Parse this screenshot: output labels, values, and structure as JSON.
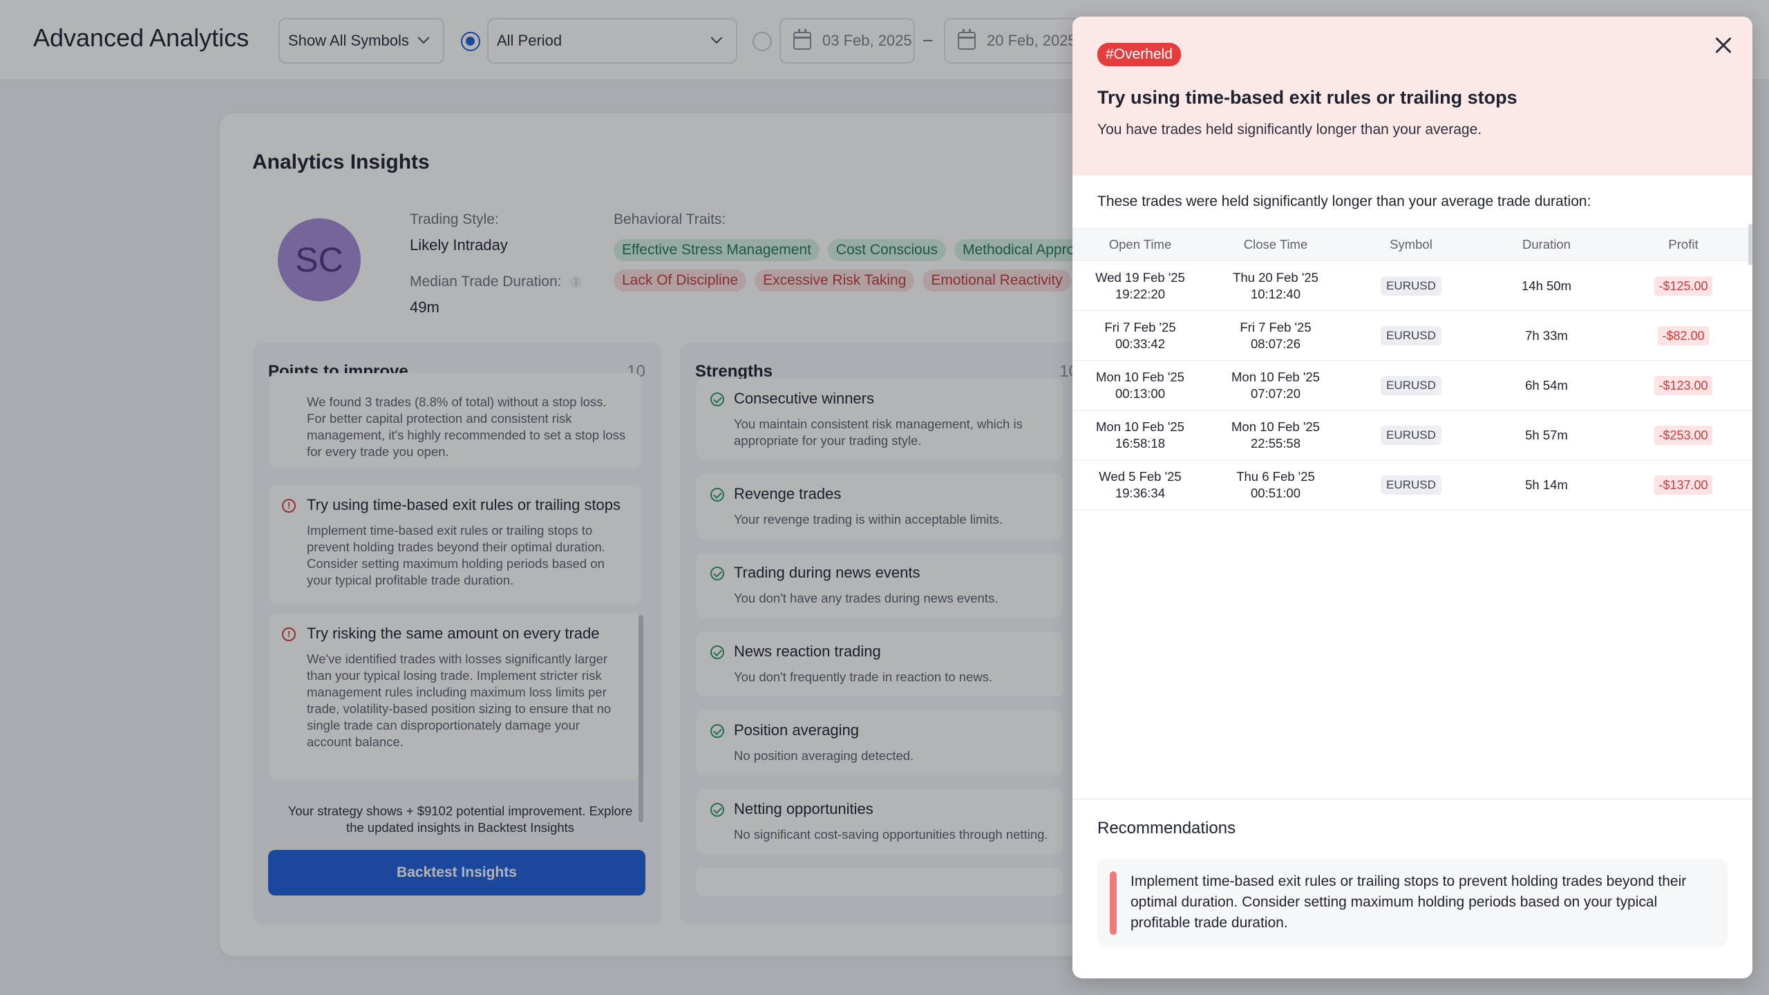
{
  "header": {
    "title": "Advanced Analytics",
    "symbols_select": "Show All Symbols",
    "period_select": "All Period",
    "date_from": "03 Feb, 2025",
    "date_sep": "–",
    "date_to": "20 Feb, 2025"
  },
  "insights": {
    "title": "Analytics Insights",
    "avatar_initials": "SC",
    "trading_style_label": "Trading Style:",
    "trading_style_value": "Likely Intraday",
    "median_label": "Median Trade Duration:",
    "median_value": "49m",
    "traits_label": "Behavioral Traits:",
    "positive_traits": [
      "Effective Stress Management",
      "Cost Conscious",
      "Methodical Approach"
    ],
    "negative_traits": [
      "Lack Of Discipline",
      "Excessive Risk Taking",
      "Emotional Reactivity"
    ]
  },
  "improve": {
    "title": "Points to improve",
    "count": "10",
    "items": [
      {
        "title": "",
        "desc": "We found 3 trades (8.8% of total) without a stop loss. For better capital protection and consistent risk management, it's highly recommended to set a stop loss for every trade you open."
      },
      {
        "title": "Try using time-based exit rules or trailing stops",
        "desc": "Implement time-based exit rules or trailing stops to prevent holding trades beyond their optimal duration. Consider setting maximum holding periods based on your typical profitable trade duration."
      },
      {
        "title": "Try risking the same amount on every trade",
        "desc": "We've identified trades with losses significantly larger than your typical losing trade. Implement stricter risk management rules including maximum loss limits per trade, volatility-based position sizing to ensure that no single trade can disproportionately damage your account balance."
      }
    ],
    "potential_text": "Your strategy shows + $9102 potential improvement. Explore the updated insights in Backtest Insights",
    "button": "Backtest Insights"
  },
  "strengths": {
    "title": "Strengths",
    "count": "10",
    "items": [
      {
        "title": "Consecutive winners",
        "desc": "You maintain consistent risk management, which is appropriate for your trading style."
      },
      {
        "title": "Revenge trades",
        "desc": "Your revenge trading is within acceptable limits."
      },
      {
        "title": "Trading during news events",
        "desc": "You don't have any trades during news events."
      },
      {
        "title": "News reaction trading",
        "desc": "You don't frequently trade in reaction to news."
      },
      {
        "title": "Position averaging",
        "desc": "No position averaging detected."
      },
      {
        "title": "Netting opportunities",
        "desc": "No significant cost-saving opportunities through netting."
      }
    ]
  },
  "drawer": {
    "tag": "#Overheld",
    "title": "Try using time-based exit rules or trailing stops",
    "subtitle": "You have trades held significantly longer than your average.",
    "table_intro": "These trades were held significantly longer than your average trade duration:",
    "columns": [
      "Open Time",
      "Close Time",
      "Symbol",
      "Duration",
      "Profit"
    ],
    "rows": [
      {
        "open1": "Wed 19 Feb '25",
        "open2": "19:22:20",
        "close1": "Thu 20 Feb '25",
        "close2": "10:12:40",
        "symbol": "EURUSD",
        "duration": "14h 50m",
        "profit": "-$125.00"
      },
      {
        "open1": "Fri 7 Feb '25",
        "open2": "00:33:42",
        "close1": "Fri 7 Feb '25",
        "close2": "08:07:26",
        "symbol": "EURUSD",
        "duration": "7h 33m",
        "profit": "-$82.00"
      },
      {
        "open1": "Mon 10 Feb '25",
        "open2": "00:13:00",
        "close1": "Mon 10 Feb '25",
        "close2": "07:07:20",
        "symbol": "EURUSD",
        "duration": "6h 54m",
        "profit": "-$123.00"
      },
      {
        "open1": "Mon 10 Feb '25",
        "open2": "16:58:18",
        "close1": "Mon 10 Feb '25",
        "close2": "22:55:58",
        "symbol": "EURUSD",
        "duration": "5h 57m",
        "profit": "-$253.00"
      },
      {
        "open1": "Wed 5 Feb '25",
        "open2": "19:36:34",
        "close1": "Thu 6 Feb '25",
        "close2": "00:51:00",
        "symbol": "EURUSD",
        "duration": "5h 14m",
        "profit": "-$137.00"
      }
    ],
    "rec_title": "Recommendations",
    "rec_text": "Implement time-based exit rules or trailing stops to prevent holding trades beyond their optimal duration. Consider setting maximum holding periods based on your typical profitable trade duration."
  },
  "colors": {
    "accent": "#1f5fd9",
    "danger": "#e53d3d",
    "success": "#2e9a6a",
    "avatar": "#a58bd8"
  }
}
